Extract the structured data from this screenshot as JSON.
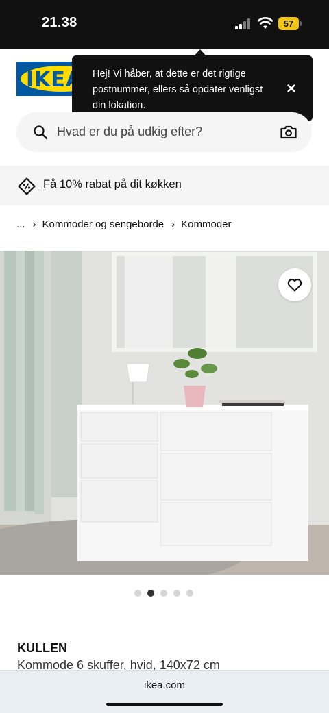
{
  "status_bar": {
    "time": "21.38",
    "battery": "57"
  },
  "header": {
    "logo_text": "IKEA"
  },
  "tooltip": {
    "message": "Hej! Vi håber, at dette er det rigtige postnummer, ellers så opdater venligst din lokation."
  },
  "search": {
    "placeholder": "Hvad er du på udkig efter?"
  },
  "promo": {
    "link_text": "Få 10% rabat på dit køkken"
  },
  "breadcrumb": {
    "items": [
      "...",
      "Kommoder og sengeborde",
      "Kommoder"
    ]
  },
  "gallery": {
    "count": 5,
    "active_index": 1
  },
  "product": {
    "name": "KULLEN",
    "description": "Kommode 6 skuffer, hvid, 140x72 cm"
  },
  "browser": {
    "url": "ikea.com"
  },
  "colors": {
    "brand_blue": "#0058a3",
    "brand_yellow": "#ffdb00",
    "tooltip_bg": "#111111"
  }
}
